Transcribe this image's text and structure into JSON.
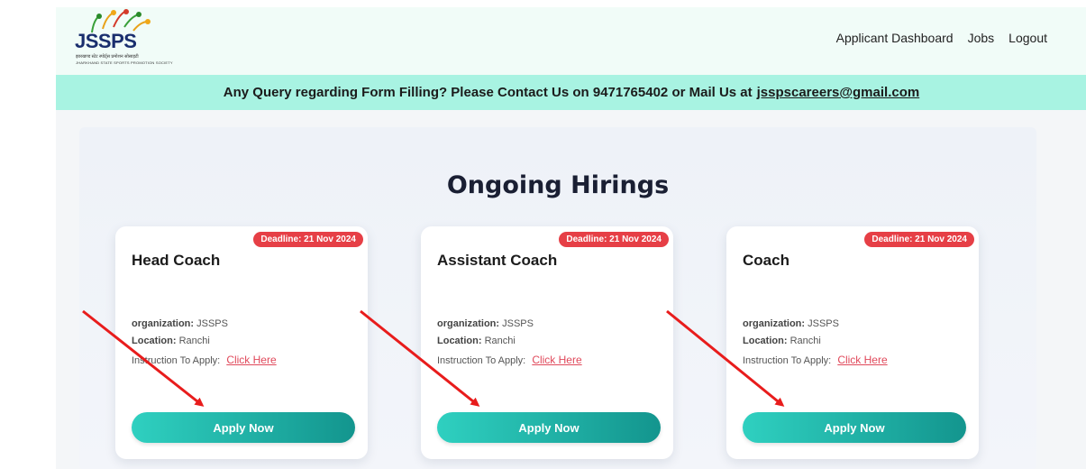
{
  "header": {
    "logo_text": "JSSPS",
    "logo_subtitle_1": "झारखण्ड स्टेट स्पोर्ट्स प्रमोशन सोसाइटी",
    "logo_subtitle_2": "JHARKHAND STATE SPORTS PROMOTION SOCIETY",
    "nav": {
      "dashboard": "Applicant Dashboard",
      "jobs": "Jobs",
      "logout": "Logout"
    }
  },
  "notice": {
    "text": "Any Query regarding Form Filling? Please Contact Us on 9471765402 or Mail Us at",
    "email": "jsspscareers@gmail.com"
  },
  "main": {
    "heading": "Ongoing Hirings",
    "cards": [
      {
        "title": "Head Coach",
        "deadline": "Deadline: 21 Nov 2024",
        "organization_label": "organization:",
        "organization": "JSSPS",
        "location_label": "Location:",
        "location": "Ranchi",
        "instruction_label": "Instruction To Apply:",
        "instruction_link": "Click Here",
        "apply_label": "Apply Now"
      },
      {
        "title": "Assistant Coach",
        "deadline": "Deadline: 21 Nov 2024",
        "organization_label": "organization:",
        "organization": "JSSPS",
        "location_label": "Location:",
        "location": "Ranchi",
        "instruction_label": "Instruction To Apply:",
        "instruction_link": "Click Here",
        "apply_label": "Apply Now"
      },
      {
        "title": "Coach",
        "deadline": "Deadline: 21 Nov 2024",
        "organization_label": "organization:",
        "organization": "JSSPS",
        "location_label": "Location:",
        "location": "Ranchi",
        "instruction_label": "Instruction To Apply:",
        "instruction_link": "Click Here",
        "apply_label": "Apply Now"
      }
    ]
  },
  "colors": {
    "accent_teal": "#13958e",
    "badge_red": "#e63f46",
    "notice_bg": "#a8f3e2",
    "annotation_arrow": "#e81c1c"
  }
}
